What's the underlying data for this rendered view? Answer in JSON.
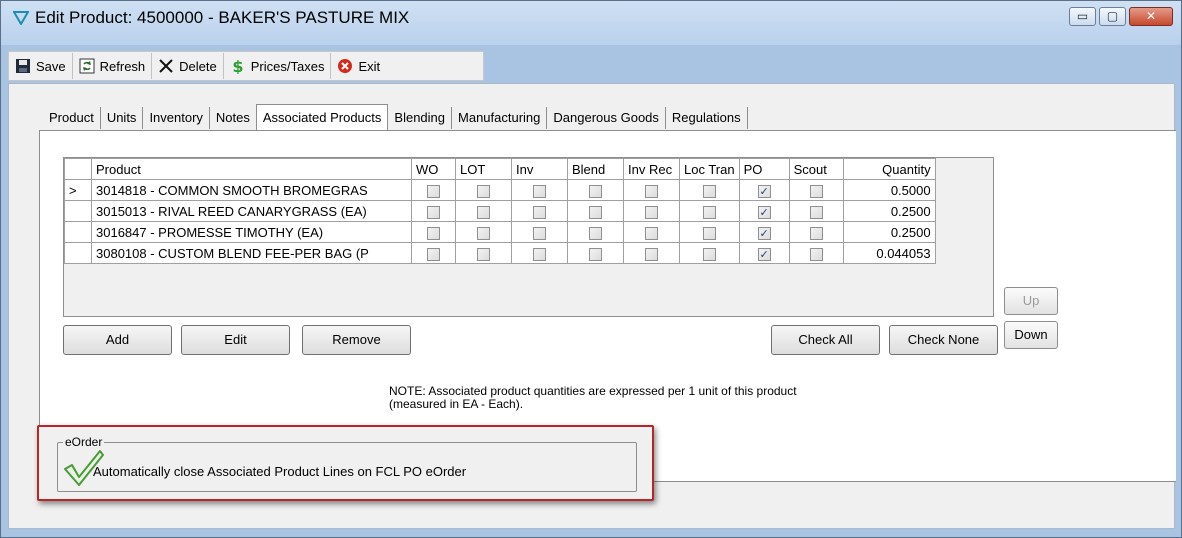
{
  "window": {
    "title": "Edit Product: 4500000 - BAKER'S PASTURE MIX",
    "controls": {
      "minimize": "▭",
      "maximize": "▢",
      "close": "✕"
    }
  },
  "toolbar": {
    "save": "Save",
    "refresh": "Refresh",
    "delete": "Delete",
    "prices_taxes": "Prices/Taxes",
    "exit": "Exit"
  },
  "tabs": [
    {
      "label": "Product"
    },
    {
      "label": "Units"
    },
    {
      "label": "Inventory"
    },
    {
      "label": "Notes"
    },
    {
      "label": "Associated Products",
      "active": true
    },
    {
      "label": "Blending"
    },
    {
      "label": "Manufacturing"
    },
    {
      "label": "Dangerous Goods"
    },
    {
      "label": "Regulations"
    }
  ],
  "grid": {
    "columns": [
      "Product",
      "WO",
      "LOT",
      "Inv",
      "Blend",
      "Inv Rec",
      "Loc Tran",
      "PO",
      "Scout",
      "Quantity"
    ],
    "current_row_marker": ">",
    "rows": [
      {
        "product": "3014818 - COMMON SMOOTH BROMEGRAS",
        "checks": [
          false,
          false,
          false,
          false,
          false,
          false,
          true,
          false
        ],
        "quantity": "0.5000"
      },
      {
        "product": "3015013 - RIVAL REED CANARYGRASS (EA)",
        "checks": [
          false,
          false,
          false,
          false,
          false,
          false,
          true,
          false
        ],
        "quantity": "0.2500"
      },
      {
        "product": "3016847 - PROMESSE TIMOTHY (EA)",
        "checks": [
          false,
          false,
          false,
          false,
          false,
          false,
          true,
          false
        ],
        "quantity": "0.2500"
      },
      {
        "product": "3080108 - CUSTOM BLEND FEE-PER BAG (P",
        "checks": [
          false,
          false,
          false,
          false,
          false,
          false,
          true,
          false
        ],
        "quantity": "0.044053"
      }
    ]
  },
  "buttons": {
    "up": "Up",
    "down": "Down",
    "add": "Add",
    "edit": "Edit",
    "remove": "Remove",
    "check_all": "Check All",
    "check_none": "Check None"
  },
  "note": {
    "line1": "NOTE:  Associated product quantities are expressed per 1 unit of this product",
    "line2": "(measured in EA - Each)."
  },
  "eorder": {
    "group_label": "eOrder",
    "checkbox_label": "Automatically close Associated Product Lines on FCL PO eOrder",
    "checked": true
  },
  "colors": {
    "highlight": "#b8262a",
    "checkmark": "#4a9a3a"
  }
}
